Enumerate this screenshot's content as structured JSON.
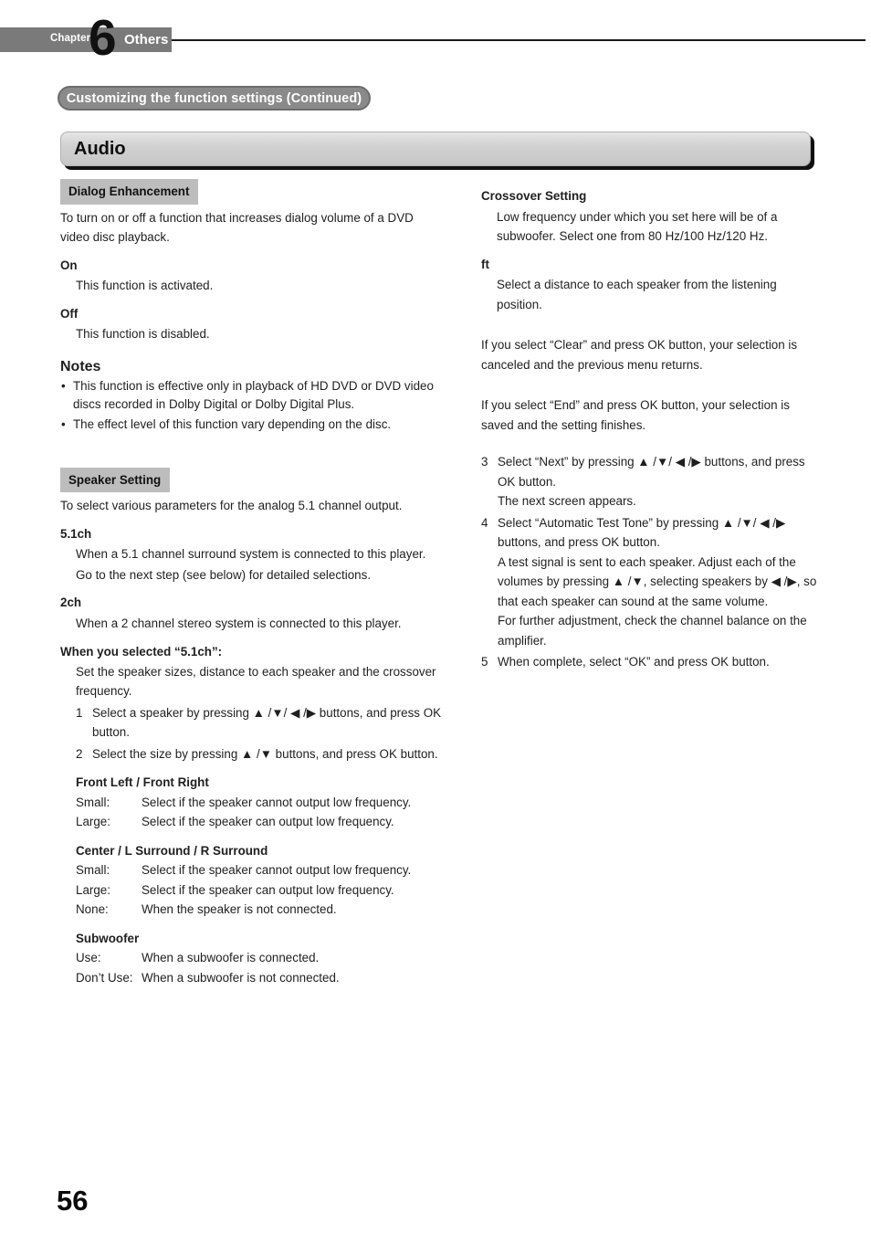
{
  "header": {
    "chapter_word": "Chapter",
    "chapter_number": "6",
    "chapter_title": "Others",
    "running_title": "Customizing the function settings (Continued)"
  },
  "section": {
    "title": "Audio"
  },
  "left_column": {
    "dialog_enhancement": {
      "tag": "Dialog Enhancement",
      "intro": "To turn on or off a function that increases dialog volume of a DVD video disc playback.",
      "options": [
        {
          "term": "On",
          "definition": "This function is activated."
        },
        {
          "term": "Off",
          "definition": "This function is disabled."
        }
      ],
      "notes_heading": "Notes",
      "notes": [
        "This function is effective only in playback of HD DVD or DVD video discs recorded in Dolby Digital or Dolby Digital Plus.",
        "The effect level of this function vary depending on the disc."
      ]
    },
    "speaker_setting": {
      "tag": "Speaker Setting",
      "intro": "To select various parameters for the analog 5.1 channel output.",
      "options": [
        {
          "term": "5.1ch",
          "definition": "When a 5.1 channel surround system is connected to this player.",
          "definition2": "Go to the next step (see below) for detailed selections."
        },
        {
          "term": "2ch",
          "definition": "When a 2 channel stereo system is connected to this player."
        }
      ],
      "selected_heading": "When you selected “5.1ch”:",
      "selected_intro": "Set the speaker sizes, distance to each speaker and the crossover frequency.",
      "steps": [
        {
          "num": "1",
          "text": "Select a speaker by pressing ▲ /▼/ ◀ /▶ buttons, and press OK button."
        },
        {
          "num": "2",
          "text": "Select the size by pressing ▲ /▼ buttons, and press OK button."
        }
      ],
      "speaker_groups": [
        {
          "name": "Front Left / Front Right",
          "rows": [
            {
              "key": "Small:",
              "value": "Select if the speaker cannot output low frequency."
            },
            {
              "key": "Large:",
              "value": "Select if the speaker can output low frequency."
            }
          ]
        },
        {
          "name": "Center / L Surround / R Surround",
          "rows": [
            {
              "key": "Small:",
              "value": "Select if the speaker cannot output low frequency."
            },
            {
              "key": "Large:",
              "value": "Select if the speaker can output low frequency."
            },
            {
              "key": "None:",
              "value": "When the speaker is not connected."
            }
          ]
        },
        {
          "name": "Subwoofer",
          "rows": [
            {
              "key": "Use:",
              "value": "When a subwoofer is connected."
            },
            {
              "key": "Don’t Use:",
              "value": "When a subwoofer is not connected."
            }
          ]
        }
      ]
    }
  },
  "right_column": {
    "crossover": {
      "term": "Crossover Setting",
      "definition": "Low frequency under which you set here will be of a subwoofer. Select one from 80 Hz/100 Hz/120 Hz."
    },
    "ft": {
      "term": "ft",
      "definition": "Select a distance to each speaker from the listening position."
    },
    "clear_note": "If you select “Clear” and press OK button, your selection is canceled and the previous menu returns.",
    "end_note": "If you select “End” and press OK button, your selection is saved and the setting finishes.",
    "steps": [
      {
        "num": "3",
        "text": "Select “Next” by pressing ▲ /▼/ ◀ /▶ buttons, and press OK button.",
        "sub": [
          "The next screen appears."
        ]
      },
      {
        "num": "4",
        "text": "Select “Automatic Test Tone” by pressing ▲ /▼/ ◀ /▶ buttons, and press OK button.",
        "sub": [
          "A test signal is sent to each speaker. Adjust each of the volumes by pressing ▲ /▼, selecting speakers by ◀ /▶, so that each speaker can sound at the same volume.",
          "For further adjustment, check the channel balance on the amplifier."
        ]
      },
      {
        "num": "5",
        "text": "When complete, select “OK” and press OK button.",
        "sub": []
      }
    ]
  },
  "footer": {
    "page_number": "56"
  }
}
